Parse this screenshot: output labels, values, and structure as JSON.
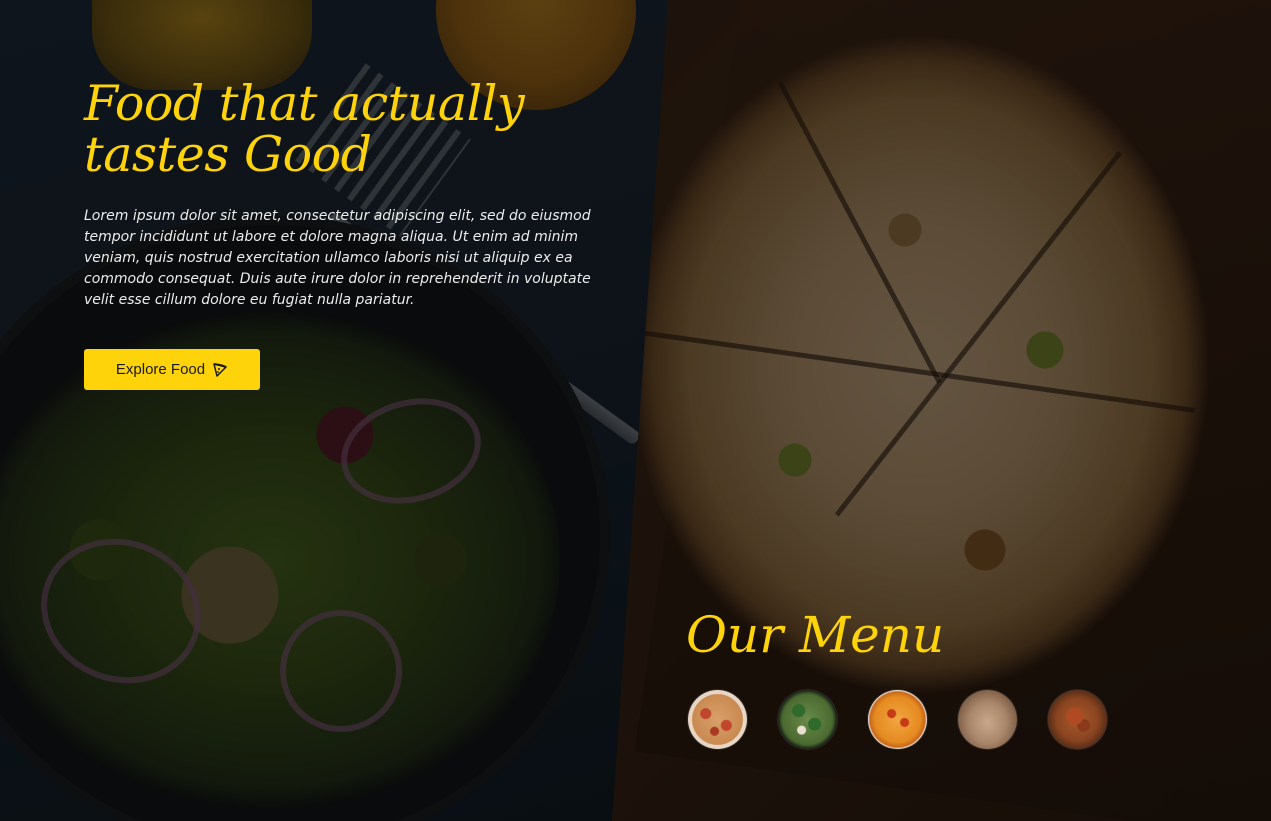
{
  "hero": {
    "title": "Food that actually tastes Good",
    "description": "Lorem ipsum dolor sit amet, consectetur adipiscing elit, sed do eiusmod tempor incididunt ut labore et dolore magna aliqua. Ut enim ad minim veniam, quis nostrud exercitation ullamco laboris nisi ut aliquip ex ea commodo consequat. Duis aute irure dolor in reprehenderit in voluptate velit esse cillum dolore eu fugiat nulla pariatur.",
    "cta_label": "Explore Food",
    "cta_icon": "pizza-slice-icon"
  },
  "menu": {
    "title": "Our Menu",
    "items": [
      {
        "icon": "pizza-thumbnail-1"
      },
      {
        "icon": "pizza-thumbnail-2"
      },
      {
        "icon": "pizza-thumbnail-3"
      },
      {
        "icon": "pizza-thumbnail-4"
      },
      {
        "icon": "pizza-thumbnail-5"
      }
    ]
  },
  "colors": {
    "accent": "#ffd30a",
    "text_light": "#ececec",
    "button_text": "#1a1a1a"
  }
}
